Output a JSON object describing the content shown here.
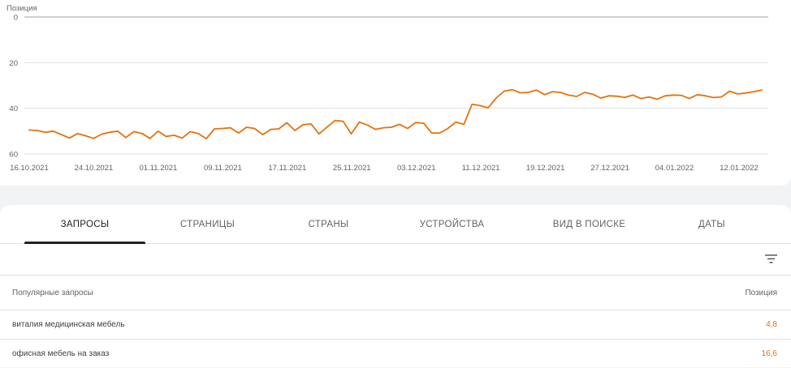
{
  "chart_data": {
    "type": "line",
    "ylabel": "Позиция",
    "y_inverted": true,
    "ylim": [
      0,
      60
    ],
    "y_ticks": [
      0,
      20,
      40,
      60
    ],
    "x_tick_labels": [
      "16.10.2021",
      "24.10.2021",
      "01.11.2021",
      "09.11.2021",
      "17.11.2021",
      "25.11.2021",
      "03.12.2021",
      "11.12.2021",
      "19.12.2021",
      "27.12.2021",
      "04.01.2022",
      "12.01.2022"
    ],
    "x_start": "16.10.2021",
    "x_end": "15.01.2022",
    "grid": true,
    "series": [
      {
        "color": "#e8710a",
        "values": [
          49.5,
          49.7,
          50.5,
          50.0,
          51.5,
          53.0,
          51.0,
          52.0,
          53.2,
          51.3,
          50.5,
          50.0,
          52.8,
          50.2,
          51.0,
          53.2,
          50.0,
          52.3,
          51.8,
          53.0,
          50.2,
          51.0,
          53.3,
          49.0,
          48.8,
          48.5,
          50.8,
          48.3,
          48.8,
          51.5,
          49.2,
          49.0,
          46.3,
          49.7,
          47.2,
          46.8,
          51.2,
          48.2,
          45.3,
          45.7,
          51.2,
          46.0,
          47.3,
          49.2,
          48.5,
          48.3,
          47.0,
          48.8,
          46.2,
          46.5,
          50.8,
          50.8,
          48.8,
          46.0,
          47.0,
          38.2,
          38.8,
          39.8,
          35.5,
          32.5,
          31.8,
          33.2,
          33.0,
          32.0,
          34.0,
          32.7,
          33.0,
          34.2,
          34.8,
          33.0,
          33.8,
          35.5,
          34.5,
          34.7,
          35.2,
          34.2,
          35.7,
          35.0,
          36.0,
          34.5,
          34.2,
          34.3,
          35.7,
          34.0,
          34.5,
          35.3,
          35.0,
          32.5,
          33.7,
          33.3,
          32.7,
          32.0
        ]
      }
    ]
  },
  "tabs": {
    "queries": "Запросы",
    "pages": "Страницы",
    "countries": "Страны",
    "devices": "Устройства",
    "search_appearance": "Вид в поиске",
    "dates": "Даты"
  },
  "table": {
    "col_query": "Популярные запросы",
    "col_position": "Позиция",
    "rows": [
      {
        "query": "виталия медицинская мебель",
        "position": "4,8"
      },
      {
        "query": "офисная мебель на заказ",
        "position": "16,6"
      }
    ]
  },
  "icons": {
    "filter": "filter-icon"
  },
  "colors": {
    "accent": "#e8710a",
    "grid": "#e0e0e0"
  }
}
